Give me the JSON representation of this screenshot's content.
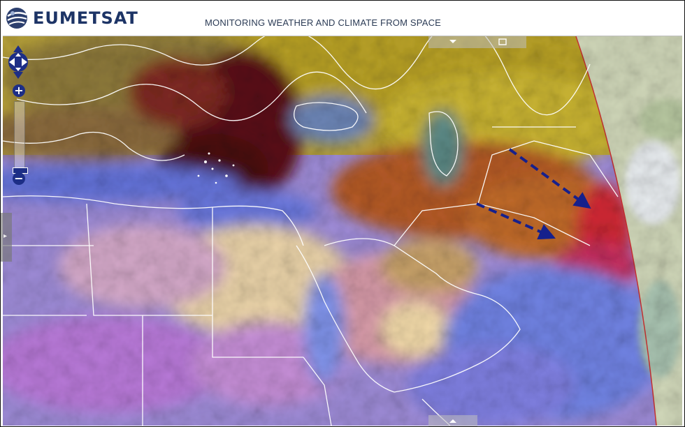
{
  "header": {
    "logo_text": "EUMETSAT",
    "tagline": "MONITORING WEATHER AND CLIMATE FROM SPACE"
  },
  "map": {
    "type": "satellite imagery (RGB composite)",
    "region": "Middle East / North Africa",
    "annotation_arrow_color": "#16208c",
    "arrow_count": 2
  },
  "controls": {
    "zoom_in_label": "+",
    "zoom_out_label": "−",
    "zoom_out_label_2": "−"
  },
  "colors": {
    "brand": "#1d3466",
    "control": "#1d2e86"
  },
  "icons": {
    "logo": "globe-icon",
    "pan": "pan-arrows-icon",
    "collapse_top": "chevron-down-icon",
    "expand_top": "square-icon",
    "collapse_bottom": "chevron-up-icon",
    "side": "chevron-right-icon"
  }
}
